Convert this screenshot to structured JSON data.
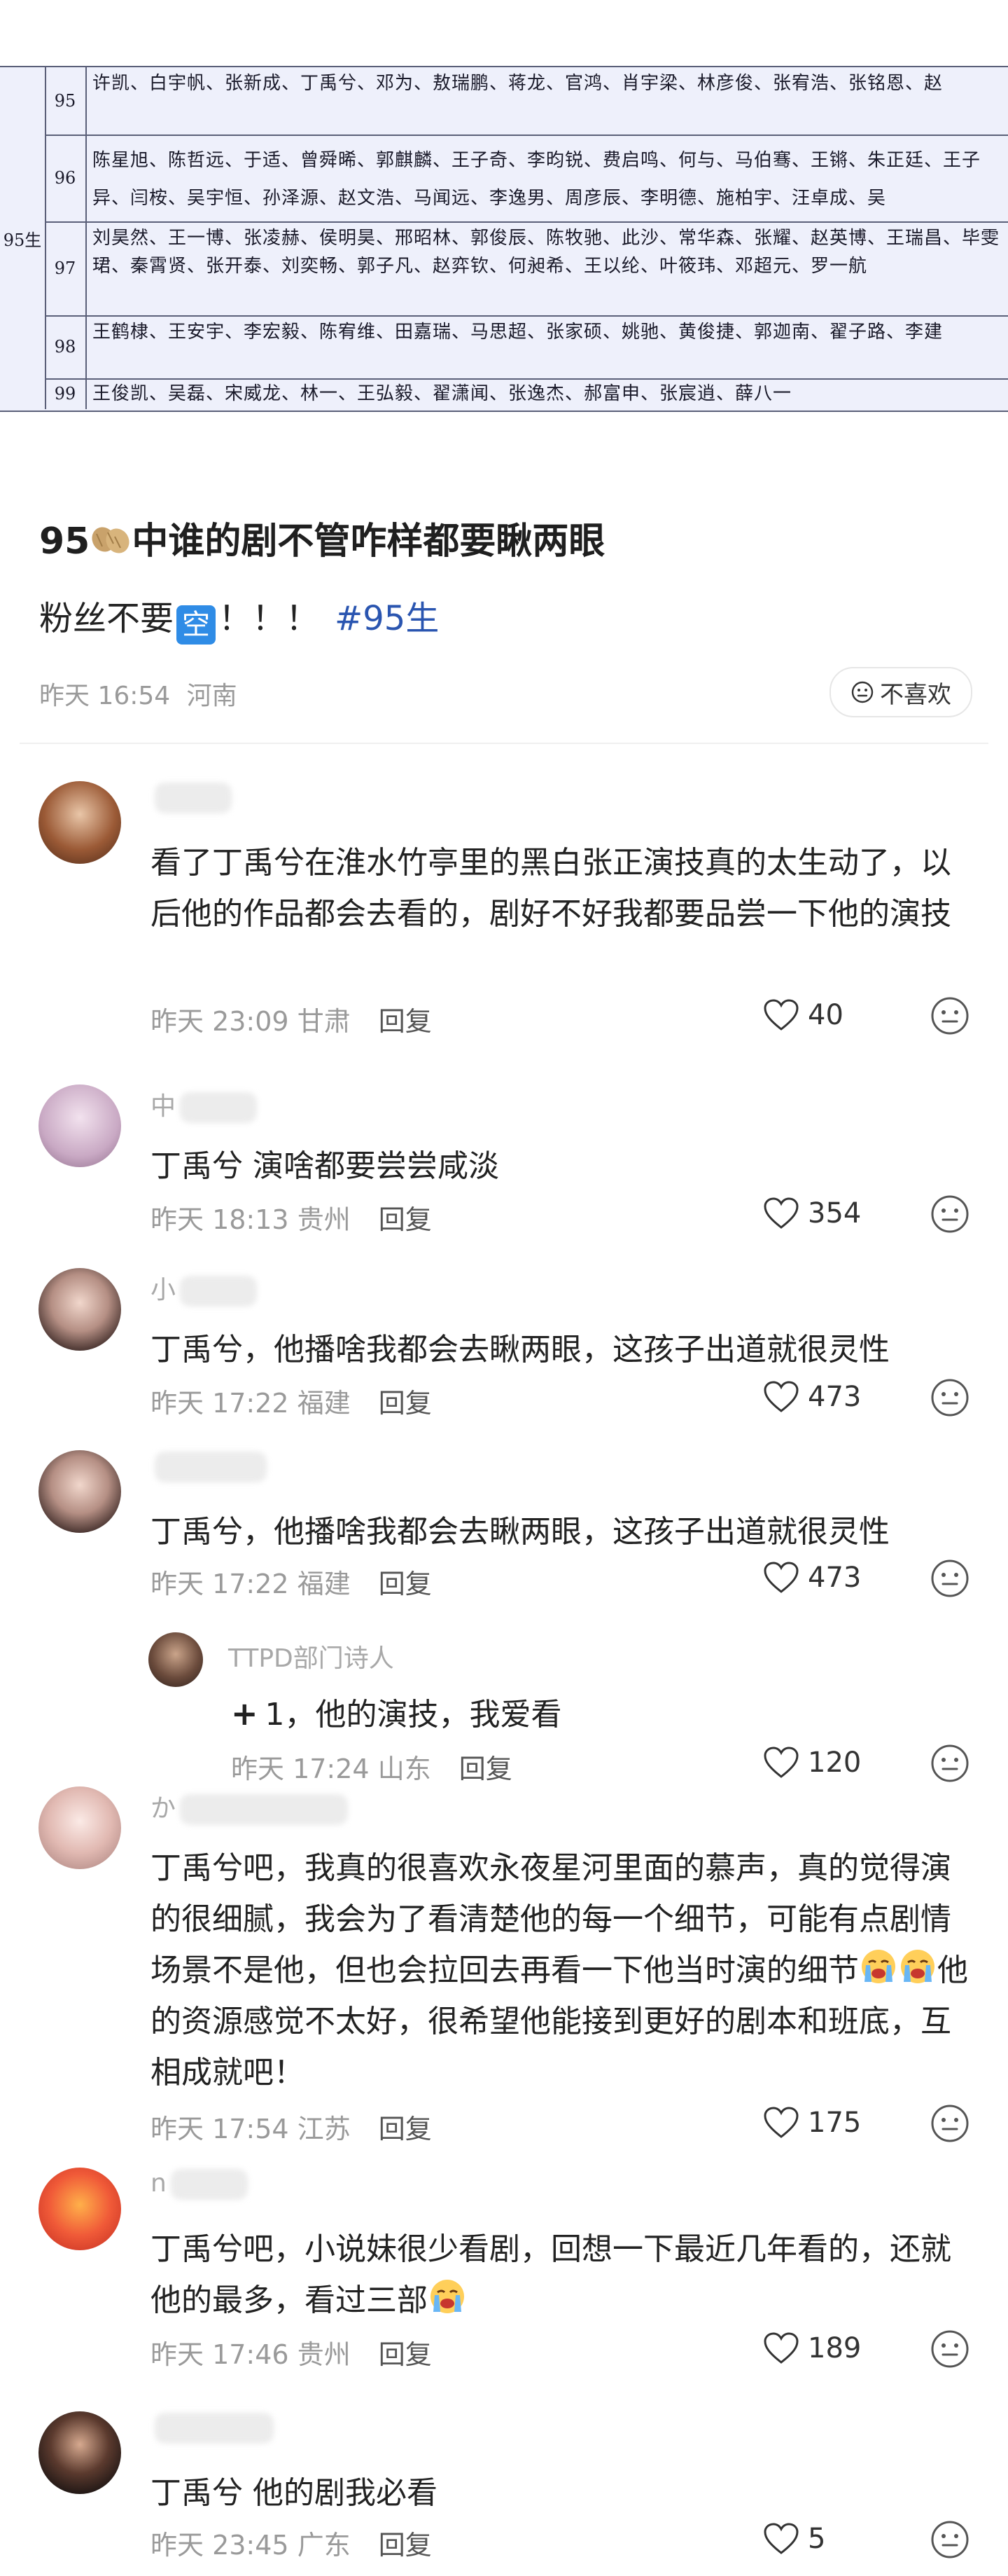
{
  "roster": {
    "group_label": "95生",
    "rows": [
      {
        "num": "95",
        "names": "许凯、白宇帆、张新成、丁禹兮、邓为、敖瑞鹏、蒋龙、官鸿、肖宇梁、林彦俊、张宥浩、张铭恩、赵"
      },
      {
        "num": "96",
        "names": "陈星旭、陈哲远、于适、曾舜晞、郭麒麟、王子奇、李昀锐、费启鸣、何与、马伯骞、王锵、朱正廷、王子异、闫桉、吴宇恒、孙泽源、赵文浩、马闻远、李逸男、周彦辰、李明德、施柏宇、汪卓成、吴"
      },
      {
        "num": "97",
        "names": "刘昊然、王一博、张凌赫、侯明昊、邢昭林、郭俊辰、陈牧驰、此沙、常华森、张耀、赵英博、王瑞昌、毕雯珺、秦霄贤、张开泰、刘奕畅、郭子凡、赵弈钦、何昶希、王以纶、叶筱玮、邓超元、罗一航"
      },
      {
        "num": "98",
        "names": "王鹤棣、王安宇、李宏毅、陈宥维、田嘉瑞、马思超、张家硕、姚驰、黄俊捷、郭迦南、翟子路、李建"
      },
      {
        "num": "99",
        "names": "王俊凯、吴磊、宋威龙、林一、王弘毅、翟潇闻、张逸杰、郝富申、张宸逍、薛八一"
      }
    ]
  },
  "post": {
    "title_prefix": "95",
    "title_emoji": "peanut-emoji",
    "title_suffix": "中谁的剧不管咋样都要瞅两眼",
    "body_prefix": "粉丝不要",
    "body_badge": "空",
    "body_suffix": "！！！",
    "hashtag": "#95生",
    "time": "昨天 16:54",
    "location": "河南",
    "dislike_label": "不喜欢"
  },
  "comments": [
    {
      "user": "",
      "text": "看了丁禹兮在淮水竹亭里的黑白张正演技真的太生动了，以后他的作品都会去看的，剧好不好我都要品尝一下他的演技",
      "time": "昨天 23:09",
      "location": "甘肃",
      "reply": "回复",
      "likes": "40"
    },
    {
      "user": "中",
      "text": "丁禹兮 演啥都要尝尝咸淡",
      "time": "昨天 18:13",
      "location": "贵州",
      "reply": "回复",
      "likes": "354"
    },
    {
      "user": "小",
      "text": "丁禹兮，他播啥我都会去瞅两眼，这孩子出道就很灵性",
      "time": "昨天 17:22",
      "location": "福建",
      "reply": "回复",
      "likes": "473"
    },
    {
      "user": "",
      "text": "丁禹兮，他播啥我都会去瞅两眼，这孩子出道就很灵性",
      "time": "昨天 17:22",
      "location": "福建",
      "reply": "回复",
      "likes": "473"
    },
    {
      "user": "TTPD部门诗人",
      "plus": "+",
      "text": "1，他的演技，我爱看",
      "time": "昨天 17:24",
      "location": "山东",
      "reply": "回复",
      "likes": "120"
    },
    {
      "user": "か",
      "text": "丁禹兮吧，我真的很喜欢永夜星河里面的慕声，真的觉得演的很细腻，我会为了看清楚他的每一个细节，可能有点剧情场景不是他，但也会拉回去再看一下他当时演的细节",
      "text2": "他的资源感觉不太好，很希望他能接到更好的剧本和班底，互相成就吧！",
      "time": "昨天 17:54",
      "location": "江苏",
      "reply": "回复",
      "likes": "175"
    },
    {
      "user": "n",
      "text": "丁禹兮吧，小说妹很少看剧，回想一下最近几年看的，还就他的最多，看过三部",
      "time": "昨天 17:46",
      "location": "贵州",
      "reply": "回复",
      "likes": "189"
    },
    {
      "user": "",
      "text": "丁禹兮 他的剧我必看",
      "time": "昨天 23:45",
      "location": "广东",
      "reply": "回复",
      "likes": "5"
    }
  ],
  "colors": {
    "hashtag": "#2a55b0",
    "meta": "#9a9a9a",
    "kong_badge": "#2f8ce6"
  }
}
